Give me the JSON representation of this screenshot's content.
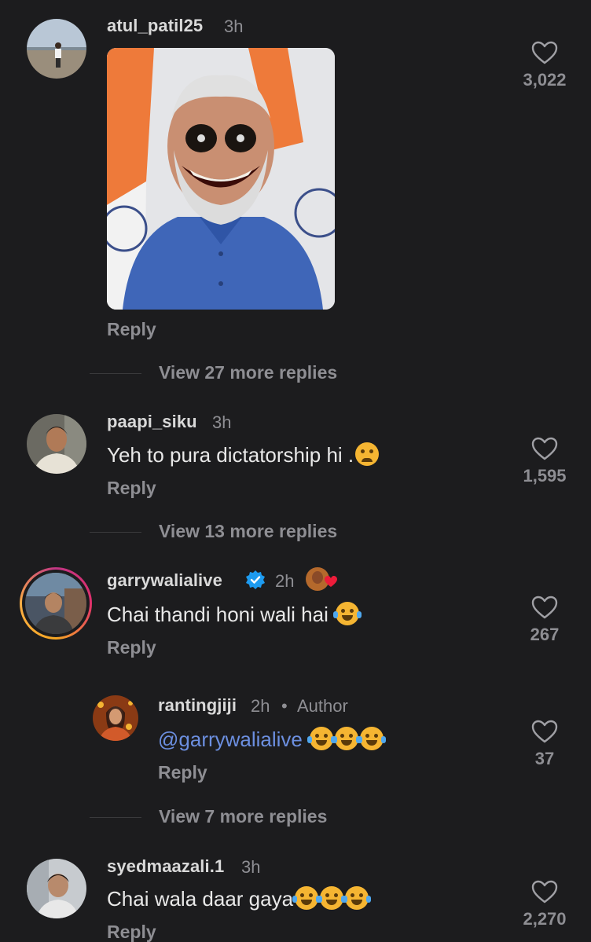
{
  "reply_label": "Reply",
  "comments": [
    {
      "username": "atul_patil25",
      "time": "3h",
      "text": "",
      "likes": "3,022",
      "view_more": "View 27 more replies"
    },
    {
      "username": "paapi_siku",
      "time": "3h",
      "text": "Yeh to pura dictatorship hi .",
      "likes": "1,595",
      "view_more": "View 13 more replies"
    },
    {
      "username": "garrywalialive",
      "time": "2h",
      "text": "Chai thandi honi wali hai",
      "likes": "267",
      "view_more": "View 7 more replies"
    },
    {
      "username": "syedmaazali.1",
      "time": "3h",
      "text": "Chai wala daar gaya",
      "likes": "2,270"
    }
  ],
  "reply_comment": {
    "username": "rantingjiji",
    "time": "2h",
    "separator": "•",
    "author_tag": "Author",
    "mention": "@garrywalialive",
    "likes": "37"
  },
  "colors": {
    "background": "#1c1c1e",
    "secondary_text": "#8e8e93",
    "mention": "#6c8fe0",
    "verified": "#1d9bf0",
    "story_ring_start": "#c13584",
    "story_ring_end": "#f5a623"
  },
  "icons": {
    "like": "heart-outline-icon",
    "verified": "verified-badge-icon",
    "emoji_sad": "sad-tear-emoji",
    "emoji_laugh": "tears-of-joy-emoji"
  }
}
